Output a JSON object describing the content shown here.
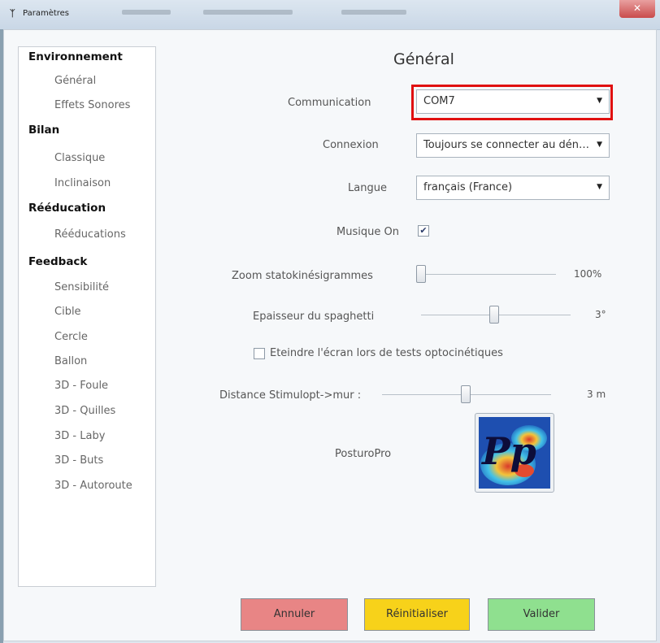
{
  "window": {
    "title": "Paramètres",
    "close_glyph": "✕"
  },
  "sidebar": {
    "sections": [
      {
        "label": "Environnement",
        "items": [
          "Général",
          "Effets Sonores"
        ]
      },
      {
        "label": "Bilan",
        "items": [
          "Classique",
          "Inclinaison"
        ]
      },
      {
        "label": "Rééducation",
        "items": [
          "Rééducations"
        ]
      },
      {
        "label": "Feedback",
        "items": [
          "Sensibilité",
          "Cible",
          "Cercle",
          "Ballon",
          "3D - Foule",
          "3D - Quilles",
          "3D - Laby",
          "3D - Buts",
          "3D - Autoroute"
        ]
      }
    ]
  },
  "main": {
    "title": "Général",
    "communication": {
      "label": "Communication",
      "value": "COM7"
    },
    "connexion": {
      "label": "Connexion",
      "value": "Toujours se connecter au dén…"
    },
    "langue": {
      "label": "Langue",
      "value": "français (France)"
    },
    "musique": {
      "label": "Musique On",
      "checked": true
    },
    "zoom": {
      "label": "Zoom statokinésigrammes",
      "value_text": "100%",
      "fraction": 0.0
    },
    "epaisseur": {
      "label": "Epaisseur du spaghetti",
      "value_text": "3°",
      "fraction": 0.5
    },
    "eteindre": {
      "label": "Eteindre l'écran lors de tests optocinétiques",
      "checked": false
    },
    "distance": {
      "label": "Distance Stimulopt->mur :",
      "value_text": "3 m",
      "fraction": 0.5
    },
    "posturopro": {
      "label": "PosturoPro",
      "logo_text": "Pp"
    }
  },
  "buttons": {
    "annuler": "Annuler",
    "reinitialiser": "Réinitialiser",
    "valider": "Valider"
  },
  "colors": {
    "annuler": "#e88585",
    "reinitialiser": "#f7d21a",
    "valider": "#8fe08f",
    "highlight": "#e01010"
  }
}
